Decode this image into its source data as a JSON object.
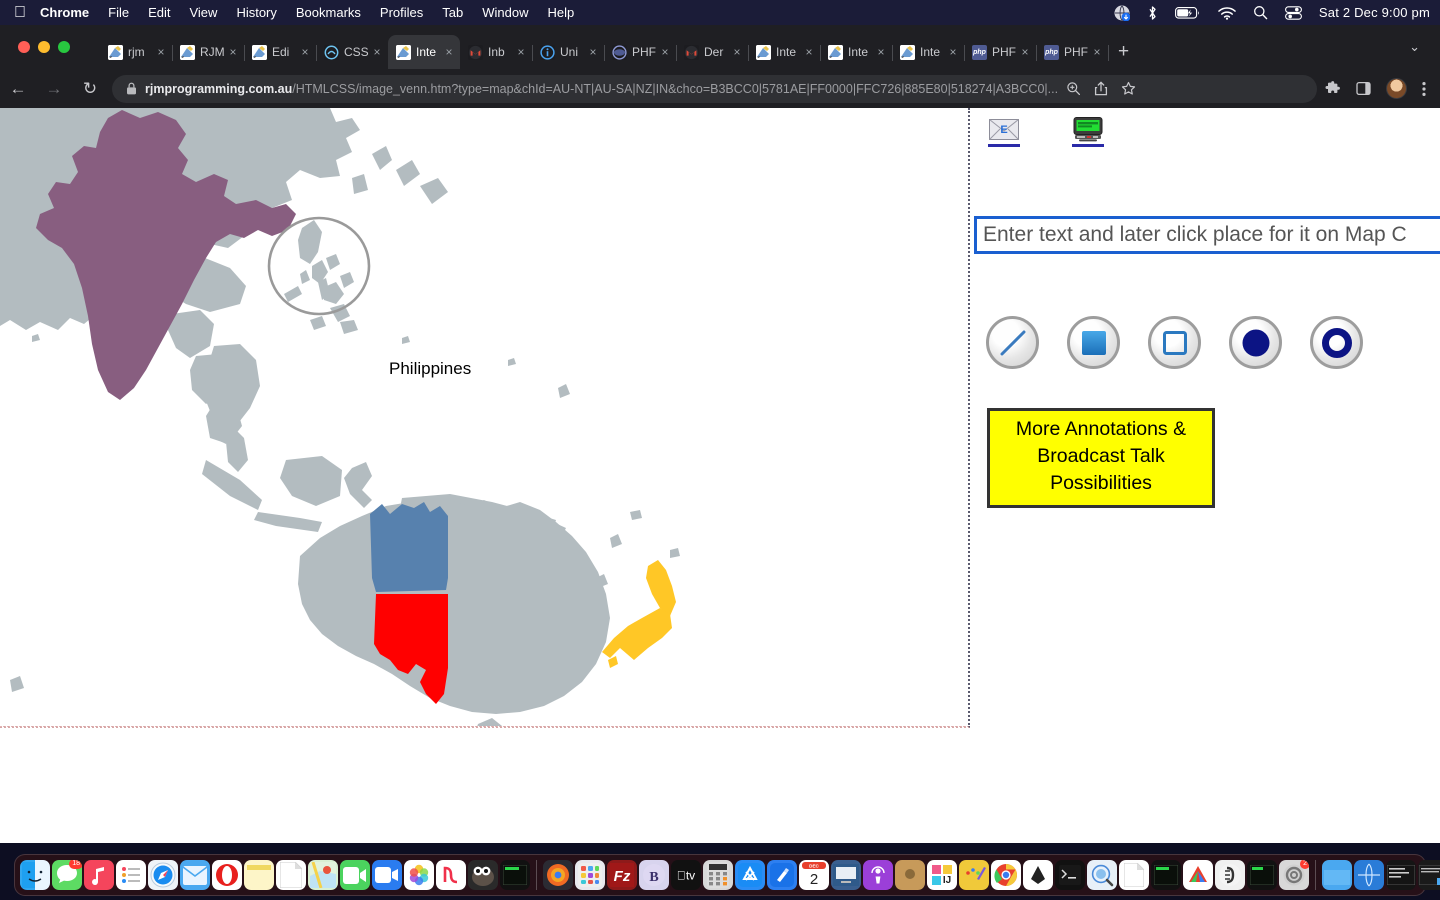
{
  "menubar": {
    "apple_icon": "apple-logo-icon",
    "items": [
      {
        "label": "Chrome",
        "bold": true
      },
      {
        "label": "File",
        "bold": false
      },
      {
        "label": "Edit",
        "bold": false
      },
      {
        "label": "View",
        "bold": false
      },
      {
        "label": "History",
        "bold": false
      },
      {
        "label": "Bookmarks",
        "bold": false
      },
      {
        "label": "Profiles",
        "bold": false
      },
      {
        "label": "Tab",
        "bold": false
      },
      {
        "label": "Window",
        "bold": false
      },
      {
        "label": "Help",
        "bold": false
      }
    ],
    "status_icons": [
      "globe-download-icon",
      "bluetooth-icon",
      "battery-charging-icon",
      "wifi-icon",
      "search-icon",
      "control-center-icon"
    ],
    "clock": "Sat 2 Dec  9:00 pm"
  },
  "browser": {
    "window_controls": [
      "close",
      "minimize",
      "maximize"
    ],
    "tabs": [
      {
        "label": "rjm",
        "favicon": "rjm-icon",
        "active": false
      },
      {
        "label": "RJM",
        "favicon": "rjm-icon",
        "active": false
      },
      {
        "label": "Edi",
        "favicon": "rjm-icon",
        "active": false
      },
      {
        "label": "CSS",
        "favicon": "css-icon",
        "active": false
      },
      {
        "label": "Inte",
        "favicon": "rjm-icon",
        "active": true
      },
      {
        "label": "Inb",
        "favicon": "gmail-icon",
        "active": false
      },
      {
        "label": "Uni",
        "favicon": "info-icon",
        "active": false
      },
      {
        "label": "PHF",
        "favicon": "php-round-icon",
        "active": false
      },
      {
        "label": "Der",
        "favicon": "gmail-icon",
        "active": false
      },
      {
        "label": "Inte",
        "favicon": "rjm-icon",
        "active": false
      },
      {
        "label": "Inte",
        "favicon": "rjm-icon",
        "active": false
      },
      {
        "label": "Inte",
        "favicon": "rjm-icon",
        "active": false
      },
      {
        "label": "PHF",
        "favicon": "php-icon",
        "active": false
      },
      {
        "label": "PHF",
        "favicon": "php-icon",
        "active": false
      }
    ],
    "new_tab_label": "+",
    "tab_list_chevron": "⌄",
    "nav": {
      "back": "←",
      "forward": "→",
      "reload": "↻"
    },
    "url_domain": "rjmprogramming.com.au",
    "url_path": "/HTMLCSS/image_venn.htm?type=map&chId=AU-NT|AU-SA|NZ|IN&chco=B3BCC0|5781AE|FF0000|FFC726|885E80|518274|A3BCC0|...",
    "omnibox_icons": [
      "zoom-icon",
      "share-icon",
      "bookmark-star-icon"
    ],
    "toolbar_icons": [
      "extensions-puzzle-icon",
      "side-panel-icon",
      "profile-avatar-icon",
      "chrome-menu-icon"
    ]
  },
  "map": {
    "annotation_label": "Philippines",
    "annotation_shape": "ellipse-outline",
    "ocean_color": "#ffffff",
    "land_color": "#b3bcc0",
    "regions": [
      {
        "name": "India",
        "code": "IN",
        "color": "#885e80"
      },
      {
        "name": "Northern Territory",
        "code": "AU-NT",
        "color": "#5781ae"
      },
      {
        "name": "South Australia",
        "code": "AU-SA",
        "color": "#ff0000"
      },
      {
        "name": "New Zealand",
        "code": "NZ",
        "color": "#ffc726"
      }
    ],
    "disclosure_triangle": "details-triangle-icon"
  },
  "panel": {
    "link_icons": [
      {
        "name": "email-icon",
        "underline_color": "#2a2aa8"
      },
      {
        "name": "terminal-monitor-icon",
        "underline_color": "#2a2aa8"
      }
    ],
    "text_input": {
      "value": "",
      "placeholder": "Enter text and later click place for it on Map C"
    },
    "shape_buttons": [
      {
        "name": "line-tool",
        "shape": "line"
      },
      {
        "name": "filled-rectangle-tool",
        "shape": "filled-rect"
      },
      {
        "name": "outline-rectangle-tool",
        "shape": "outline-rect"
      },
      {
        "name": "filled-circle-tool",
        "shape": "filled-circle"
      },
      {
        "name": "outline-circle-tool",
        "shape": "outline-circle"
      }
    ],
    "yellow_box": {
      "line1": "More Annotations &",
      "line2": "Broadcast Talk",
      "line3": "Possibilities",
      "background": "#ffff00",
      "border": "#333333"
    }
  },
  "dock": {
    "items": [
      {
        "name": "finder",
        "running": true
      },
      {
        "name": "messages",
        "running": true,
        "badge": "18"
      },
      {
        "name": "music",
        "running": false
      },
      {
        "name": "reminders",
        "running": false
      },
      {
        "name": "safari",
        "running": true
      },
      {
        "name": "mail",
        "running": true
      },
      {
        "name": "opera",
        "running": true
      },
      {
        "name": "stickies",
        "running": false
      },
      {
        "name": "textedit",
        "running": true
      },
      {
        "name": "maps",
        "running": false
      },
      {
        "name": "facetime",
        "running": false
      },
      {
        "name": "zoom",
        "running": false
      },
      {
        "name": "photos",
        "running": true
      },
      {
        "name": "news",
        "running": false
      },
      {
        "name": "gimp",
        "running": false
      },
      {
        "name": "terminal-green",
        "running": false
      },
      {
        "name": "firefox",
        "running": false
      },
      {
        "name": "launchpad",
        "running": false
      },
      {
        "name": "filezilla",
        "running": true
      },
      {
        "name": "bbedit",
        "running": true
      },
      {
        "name": "appletv",
        "running": false
      },
      {
        "name": "calculator",
        "running": false
      },
      {
        "name": "appstore",
        "running": true
      },
      {
        "name": "xcode",
        "running": false
      },
      {
        "name": "calendar",
        "running": false,
        "date": "2",
        "month": "DEC"
      },
      {
        "name": "keynote",
        "running": false
      },
      {
        "name": "podcasts",
        "running": false
      },
      {
        "name": "tan-app",
        "running": false
      },
      {
        "name": "intellij",
        "running": true
      },
      {
        "name": "paint",
        "running": true
      },
      {
        "name": "chrome",
        "running": true
      },
      {
        "name": "inkscape",
        "running": false
      },
      {
        "name": "terminal",
        "running": true
      },
      {
        "name": "preview",
        "running": false
      },
      {
        "name": "document",
        "running": false
      },
      {
        "name": "terminal-green-2",
        "running": false
      },
      {
        "name": "adobe-reader",
        "running": true
      },
      {
        "name": "evernote",
        "running": true
      },
      {
        "name": "terminal-green-3",
        "running": false
      },
      {
        "name": "settings-gear",
        "running": true,
        "badge": "2"
      },
      {
        "name": "folder-window",
        "running": false
      },
      {
        "name": "globe-window",
        "running": false
      },
      {
        "name": "terminal-window-1",
        "running": false
      },
      {
        "name": "terminal-window-2",
        "running": false
      },
      {
        "name": "terminal-window-3",
        "running": false
      },
      {
        "name": "white-window-1",
        "running": false
      },
      {
        "name": "terminal-window-4",
        "running": false
      },
      {
        "name": "white-window-2",
        "running": false
      },
      {
        "name": "trash",
        "running": false
      }
    ]
  }
}
